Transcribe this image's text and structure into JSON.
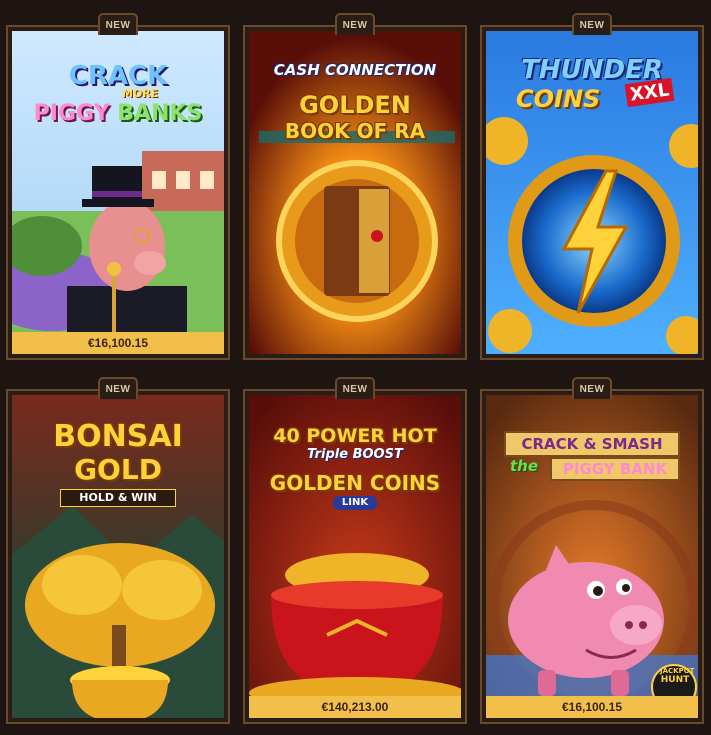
{
  "games": [
    {
      "badge": "NEW",
      "title_line1": "CRACK",
      "title_line1b": "MORE",
      "title_line2": "PIGGY",
      "title_line2b": "BANKS",
      "jackpot": "€16,100.15"
    },
    {
      "badge": "NEW",
      "title_top": "CASH CONNECTION",
      "title_line1": "GOLDEN",
      "title_line2": "BOOK OF RA"
    },
    {
      "badge": "NEW",
      "title_line1": "THUNDER",
      "title_line2": "COINS",
      "title_tag": "XXL"
    },
    {
      "badge": "NEW",
      "title_line1": "BONSAI",
      "title_line2": "GOLD",
      "title_tag": "HOLD & WIN"
    },
    {
      "badge": "NEW",
      "title_line1": "40 POWER HOT",
      "title_script": "Triple BOOST",
      "title_line2": "GOLDEN COINS",
      "title_tag": "LINK",
      "jackpot": "€140,213.00"
    },
    {
      "badge": "NEW",
      "title_line1": "CRACK & SMASH",
      "title_script": "the",
      "title_line2": "PIGGY BANK",
      "logo_line1": "JACKPOT",
      "logo_line2": "HUNT",
      "jackpot": "€16,100.15"
    }
  ],
  "colors": {
    "page_bg": "#1e1512",
    "card_border": "#6b4a2c",
    "jackpot_bar": "#f2c04a"
  }
}
